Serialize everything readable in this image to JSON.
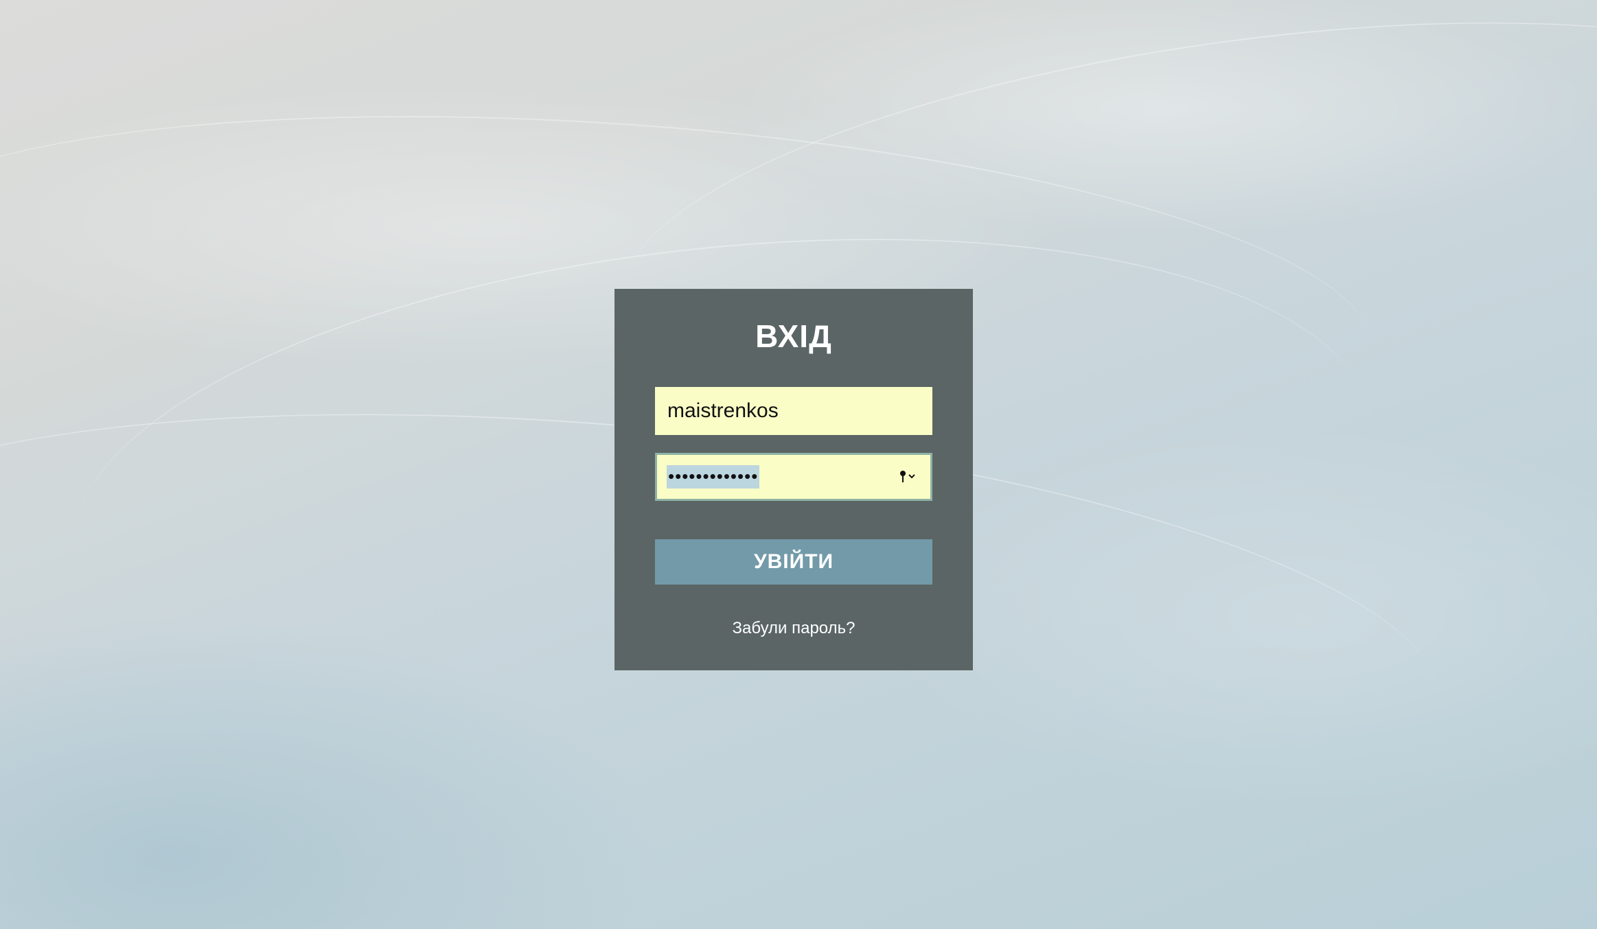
{
  "login": {
    "title": "ВХІД",
    "username_value": "maistrenkos",
    "password_mask": "•••••••••••••",
    "submit_label": "УВІЙТИ",
    "forgot_password_label": "Забули пароль?"
  },
  "colors": {
    "card_background": "#5b6565",
    "input_background": "#fafec6",
    "button_background": "#739aa9",
    "text_light": "#ffffff"
  },
  "icons": {
    "password_field": "key-icon"
  }
}
